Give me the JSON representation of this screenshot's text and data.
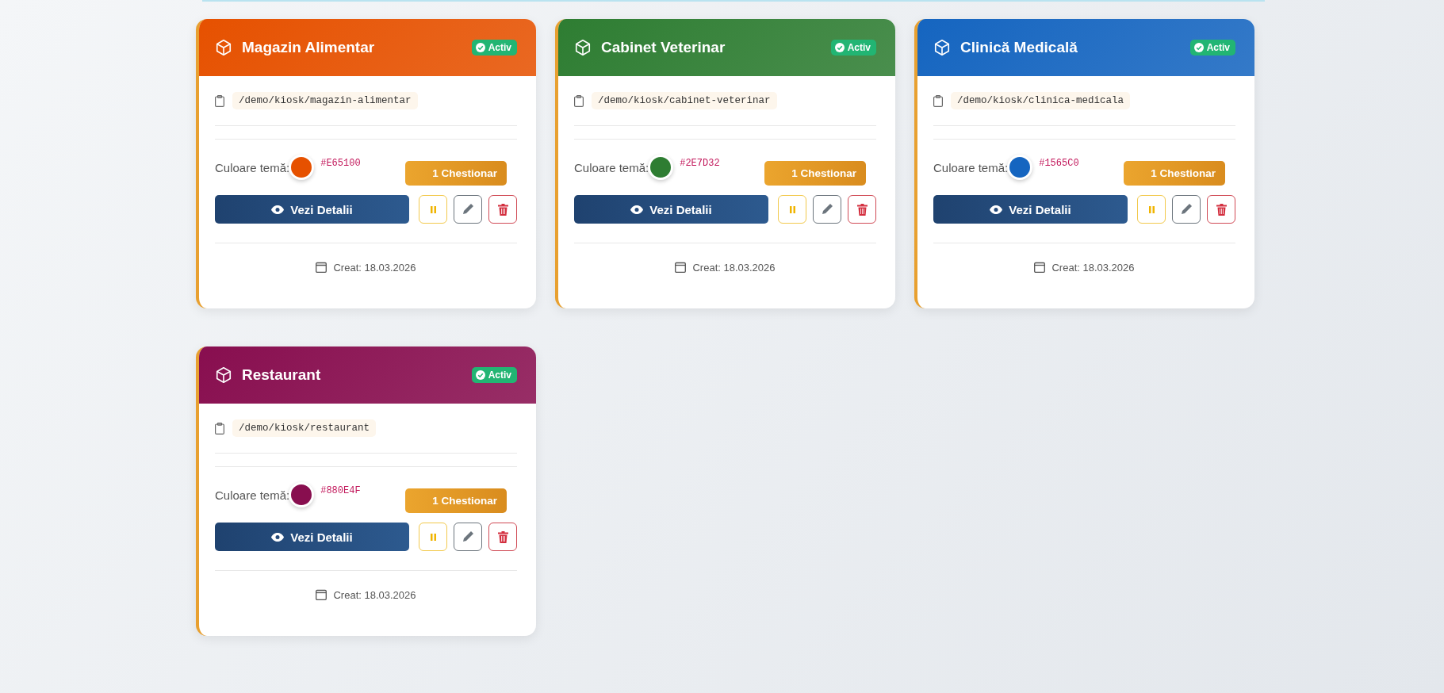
{
  "kiosks": [
    {
      "name": "Magazin Alimentar",
      "status": "Activ",
      "path": "/demo/kiosk/magazin-alimentar",
      "color_label": "Culoare temă:",
      "color": "#e65100",
      "color_code": "#E65100",
      "questionnaires": "1 Chestionar",
      "details_button": "Vezi Detalii",
      "created": "Creat: 18.03.2026"
    },
    {
      "name": "Cabinet Veterinar",
      "status": "Activ",
      "path": "/demo/kiosk/cabinet-veterinar",
      "color_label": "Culoare temă:",
      "color": "#2e7d32",
      "color_code": "#2E7D32",
      "questionnaires": "1 Chestionar",
      "details_button": "Vezi Detalii",
      "created": "Creat: 18.03.2026"
    },
    {
      "name": "Clinică Medicală",
      "status": "Activ",
      "path": "/demo/kiosk/clinica-medicala",
      "color_label": "Culoare temă:",
      "color": "#1565c0",
      "color_code": "#1565C0",
      "questionnaires": "1 Chestionar",
      "details_button": "Vezi Detalii",
      "created": "Creat: 18.03.2026"
    },
    {
      "name": "Restaurant",
      "status": "Activ",
      "path": "/demo/kiosk/restaurant",
      "color_label": "Culoare temă:",
      "color": "#880e4f",
      "color_code": "#880E4F",
      "questionnaires": "1 Chestionar",
      "details_button": "Vezi Detalii",
      "created": "Creat: 18.03.2026"
    }
  ]
}
